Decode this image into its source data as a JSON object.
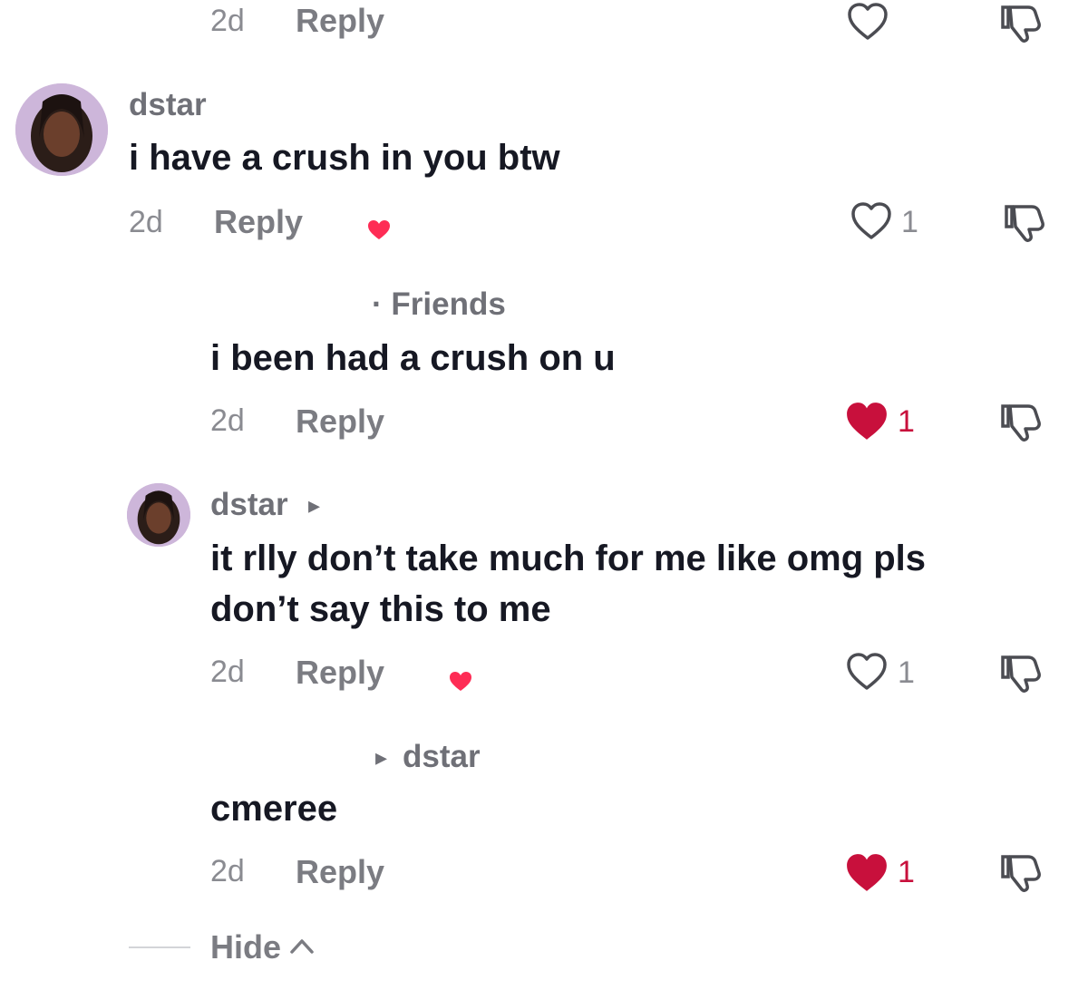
{
  "comments": [
    {
      "id": "top-fragment",
      "time": "2d",
      "reply_label": "Reply",
      "like_count": ""
    },
    {
      "id": "c1",
      "username": "dstar",
      "text": "i have a crush in you btw",
      "time": "2d",
      "reply_label": "Reply",
      "like_count": "1",
      "creator_liked": true
    },
    {
      "id": "r1",
      "username_suffix": "· Friends",
      "text": "i been had a crush on u",
      "time": "2d",
      "reply_label": "Reply",
      "like_count": "1",
      "liked": true
    },
    {
      "id": "r2",
      "username": "dstar",
      "reply_arrow": "▸",
      "text_line1": "it rlly don’t take much for me like omg pls",
      "text_line2": "don’t say this to me",
      "time": "2d",
      "reply_label": "Reply",
      "like_count": "1",
      "creator_liked": true
    },
    {
      "id": "r3",
      "reply_arrow": "▸",
      "reply_to": "dstar",
      "text": "cmeree",
      "time": "2d",
      "reply_label": "Reply",
      "like_count": "1",
      "liked": true
    }
  ],
  "footer": {
    "hide_label": "Hide",
    "hide_arrow": "^"
  },
  "colors": {
    "like_red": "#c8103c",
    "creator_heart": "#fe2c55",
    "text": "#161823",
    "muted": "#8a8b91"
  },
  "icons": [
    "heart-outline-icon",
    "heart-filled-icon",
    "dislike-icon",
    "creator-liked-heart-icon",
    "chevron-up-icon",
    "play-triangle-icon"
  ]
}
